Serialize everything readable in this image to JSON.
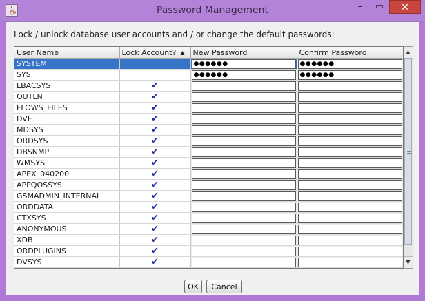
{
  "window": {
    "title": "Password Management",
    "minimize_glyph": "–",
    "restore_glyph": "▭",
    "close_glyph": "✕"
  },
  "instructions": "Lock / unlock database user accounts and / or change the default passwords:",
  "table": {
    "columns": [
      "User Name",
      "Lock Account?",
      "New Password",
      "Confirm Password"
    ],
    "sort_column": "Lock Account?",
    "sort_direction": "ascending",
    "check_glyph": "✔",
    "rows": [
      {
        "user": "SYSTEM",
        "locked": false,
        "new_password": "●●●●●●",
        "confirm_password": "●●●●●●",
        "selected": true
      },
      {
        "user": "SYS",
        "locked": false,
        "new_password": "●●●●●●",
        "confirm_password": "●●●●●●",
        "selected": false
      },
      {
        "user": "LBACSYS",
        "locked": true,
        "new_password": "",
        "confirm_password": "",
        "selected": false
      },
      {
        "user": "OUTLN",
        "locked": true,
        "new_password": "",
        "confirm_password": "",
        "selected": false
      },
      {
        "user": "FLOWS_FILES",
        "locked": true,
        "new_password": "",
        "confirm_password": "",
        "selected": false
      },
      {
        "user": "DVF",
        "locked": true,
        "new_password": "",
        "confirm_password": "",
        "selected": false
      },
      {
        "user": "MDSYS",
        "locked": true,
        "new_password": "",
        "confirm_password": "",
        "selected": false
      },
      {
        "user": "ORDSYS",
        "locked": true,
        "new_password": "",
        "confirm_password": "",
        "selected": false
      },
      {
        "user": "DBSNMP",
        "locked": true,
        "new_password": "",
        "confirm_password": "",
        "selected": false
      },
      {
        "user": "WMSYS",
        "locked": true,
        "new_password": "",
        "confirm_password": "",
        "selected": false
      },
      {
        "user": "APEX_040200",
        "locked": true,
        "new_password": "",
        "confirm_password": "",
        "selected": false
      },
      {
        "user": "APPQOSSYS",
        "locked": true,
        "new_password": "",
        "confirm_password": "",
        "selected": false
      },
      {
        "user": "GSMADMIN_INTERNAL",
        "locked": true,
        "new_password": "",
        "confirm_password": "",
        "selected": false
      },
      {
        "user": "ORDDATA",
        "locked": true,
        "new_password": "",
        "confirm_password": "",
        "selected": false
      },
      {
        "user": "CTXSYS",
        "locked": true,
        "new_password": "",
        "confirm_password": "",
        "selected": false
      },
      {
        "user": "ANONYMOUS",
        "locked": true,
        "new_password": "",
        "confirm_password": "",
        "selected": false
      },
      {
        "user": "XDB",
        "locked": true,
        "new_password": "",
        "confirm_password": "",
        "selected": false
      },
      {
        "user": "ORDPLUGINS",
        "locked": true,
        "new_password": "",
        "confirm_password": "",
        "selected": false
      },
      {
        "user": "DVSYS",
        "locked": true,
        "new_password": "",
        "confirm_password": "",
        "selected": false
      }
    ]
  },
  "buttons": {
    "ok_label": "OK",
    "cancel_label": "Cancel"
  },
  "colors": {
    "selection": "#3574c6",
    "checkmark": "#1c2ea8",
    "close_button": "#c7453f",
    "title_bar": "#b383d9"
  }
}
